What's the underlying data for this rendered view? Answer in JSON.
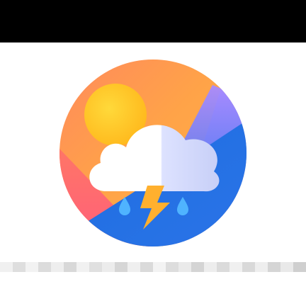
{
  "app_icon": {
    "name": "weather-thunderstorm-app-icon",
    "description_hidden": "",
    "colors": {
      "top_bar": "#000000",
      "background": "#ffffff",
      "orange_top": "#ffa348",
      "pink_left": "#ff6a70",
      "purple_right": "#9b87ff",
      "blue_bottom": "#1e6bdc",
      "sun": "#ffc11a",
      "cloud_white": "#ffffff",
      "cloud_tint": "#d2d9ff",
      "lightning": "#ffb02e",
      "raindrop": "#4fb3ff"
    }
  },
  "strip": {
    "shades": [
      "#f0f0f0",
      "#dedede",
      "#f2f2f2",
      "#dcdcdc",
      "#eeeeee",
      "#d8d8d8",
      "#f1f1f1",
      "#e0e0e0",
      "#ececec",
      "#d6d6d6",
      "#efefef",
      "#dadada",
      "#f3f3f3",
      "#dddddd",
      "#eaeaea",
      "#d4d4d4",
      "#ededed",
      "#dbdbdb",
      "#f0f0f0",
      "#d9d9d9",
      "#eeeeee",
      "#d5d5d5",
      "#e9e9e9",
      "#cfcfcf"
    ]
  }
}
